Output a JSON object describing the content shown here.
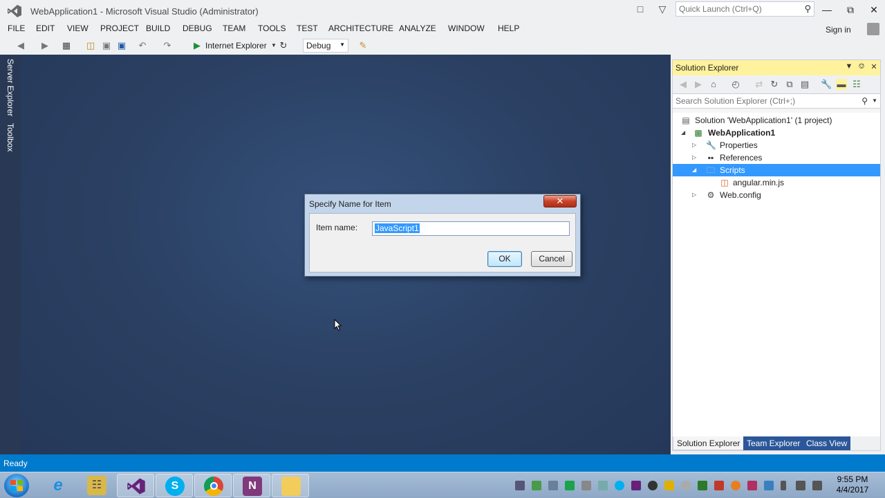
{
  "window": {
    "title": "WebApplication1 - Microsoft Visual Studio (Administrator)",
    "quick_launch_placeholder": "Quick Launch (Ctrl+Q)",
    "sign_in": "Sign in"
  },
  "menu": [
    "FILE",
    "EDIT",
    "VIEW",
    "PROJECT",
    "BUILD",
    "DEBUG",
    "TEAM",
    "TOOLS",
    "TEST",
    "ARCHITECTURE",
    "ANALYZE",
    "WINDOW",
    "HELP"
  ],
  "toolbar": {
    "run_target": "Internet Explorer",
    "configuration": "Debug"
  },
  "side_tabs": [
    "Server Explorer",
    "Toolbox"
  ],
  "solution_explorer": {
    "title": "Solution Explorer",
    "search_placeholder": "Search Solution Explorer (Ctrl+;)",
    "tree": [
      {
        "label": "Solution 'WebApplication1' (1 project)",
        "icon": "solution-icon"
      },
      {
        "label": "WebApplication1",
        "icon": "web-project-icon",
        "bold": true
      },
      {
        "label": "Properties",
        "icon": "wrench-icon"
      },
      {
        "label": "References",
        "icon": "references-icon"
      },
      {
        "label": "Scripts",
        "icon": "folder-icon",
        "selected": true
      },
      {
        "label": "angular.min.js",
        "icon": "js-file-icon"
      },
      {
        "label": "Web.config",
        "icon": "config-file-icon"
      }
    ],
    "tabs": [
      "Solution Explorer",
      "Team Explorer",
      "Class View"
    ]
  },
  "dialog": {
    "title": "Specify Name for Item",
    "label": "Item name:",
    "value": "JavaScript1",
    "ok": "OK",
    "cancel": "Cancel"
  },
  "status": {
    "text": "Ready"
  },
  "taskbar": {
    "time": "9:55 PM",
    "date": "4/4/2017",
    "apps": [
      "internet-explorer-icon",
      "network-tool-icon",
      "visual-studio-icon",
      "skype-icon",
      "chrome-icon",
      "onenote-icon",
      "file-explorer-icon"
    ]
  }
}
